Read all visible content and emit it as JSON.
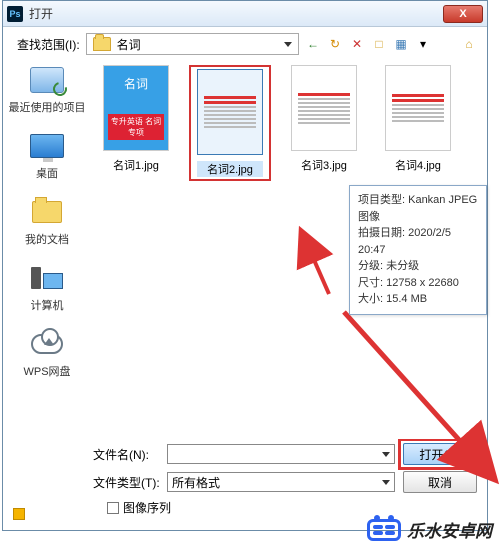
{
  "titlebar": {
    "ps": "Ps",
    "title": "打开",
    "close": "X"
  },
  "lookin": {
    "label": "查找范围(I):",
    "value": "名词"
  },
  "toolbar_icons": {
    "back": "←",
    "up": "↻",
    "del": "✕",
    "new": "□",
    "views": "▦",
    "dd": "▾",
    "pin": "⌂"
  },
  "places": {
    "recent": "最近使用的项目",
    "desktop": "桌面",
    "mydocs": "我的文档",
    "computer": "计算机",
    "wps": "WPS网盘"
  },
  "thumbs": {
    "cover_title": "名词",
    "cover_sub": "专升英语\n名词专项",
    "f1": "名词1.jpg",
    "f2": "名词2.jpg",
    "f3": "名词3.jpg",
    "f4": "名词4.jpg"
  },
  "tooltip": {
    "l1": "项目类型: Kankan JPEG 图像",
    "l2": "拍摄日期: 2020/2/5 20:47",
    "l3": "分级: 未分级",
    "l4": "尺寸: 12758 x 22680",
    "l5": "大小: 15.4 MB"
  },
  "form": {
    "fname_label": "文件名(N):",
    "ftype_label": "文件类型(T):",
    "ftype_value": "所有格式",
    "open_btn": "打开(O)",
    "cancel_btn": "取消",
    "seq_label": "图像序列"
  },
  "footer": "乐水安卓网"
}
